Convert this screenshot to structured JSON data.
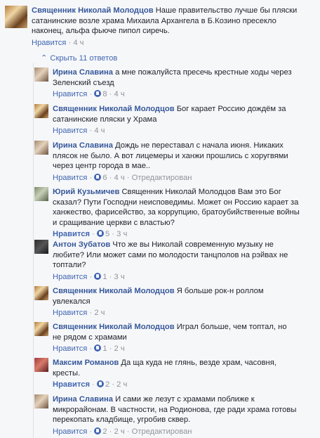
{
  "top_comment": {
    "author": "Священник Николай Молодцов",
    "text_lines": [
      "Наше правительство лучше бы пляски",
      "сатанинские возле храма Михаила Архангела в Б.Козино пресекло",
      "наконец, альфа фьюче пипол сиречь."
    ],
    "like_label": "Нравится",
    "time": "4 ч"
  },
  "replies_toggle": {
    "icon": "chevron-up-icon",
    "label": "Скрыть 11 ответов"
  },
  "replies": [
    {
      "author": "Ирина Славина",
      "text_lines": [
        "а мне пожалуйста пресечь крестные ходы через",
        "Зеленский съезд"
      ],
      "like_label": "Нравится",
      "reactions": "8",
      "time": "4 ч",
      "edited": ""
    },
    {
      "author": "Священник Николай Молодцов",
      "text_lines": [
        "Бог карает Россию дождём за",
        "сатанинские пляски у Храма"
      ],
      "like_label": "Нравится",
      "reactions": "",
      "time": "4 ч",
      "edited": ""
    },
    {
      "author": "Ирина Славина",
      "text_lines": [
        "Дождь не переставал с начала июня. Никаких",
        "плясок не было. А вот лицемеры и ханжи прошлись с хоругвями",
        "через центр города в мае.."
      ],
      "like_label": "Нравится",
      "reactions": "6",
      "time": "4 ч",
      "edited": "Отредактирован"
    },
    {
      "author": "Юрий Кузьмичев",
      "text_lines": [
        "Священник Николай Молодцов Вам это Бог",
        "сказал? Пути Господни неисповедимы. Может он Россию карает за",
        "ханжество, фарисейство, за коррупцию, братоубийственные войны",
        "и сращивание церкви с властью?"
      ],
      "like_label": "Нравится",
      "reactions": "5",
      "time": "3 ч",
      "edited": ""
    },
    {
      "author": "Антон Зубатов",
      "text_lines": [
        "Что же вы Николай современную музыку не",
        "любите? Или может сами по молодости танцполов на рэйвах не",
        "топтали?"
      ],
      "like_label": "Нравится",
      "reactions": "1",
      "time": "3 ч",
      "edited": ""
    },
    {
      "author": "Священник Николай Молодцов",
      "text_lines": [
        "Я больше рок-н роллом",
        "увлекался"
      ],
      "like_label": "Нравится",
      "reactions": "",
      "time": "2 ч",
      "edited": ""
    },
    {
      "author": "Священник Николай Молодцов",
      "text_lines": [
        "Играл больше, чем топтал, но",
        "не рядом с храмами"
      ],
      "like_label": "Нравится",
      "reactions": "1",
      "time": "2 ч",
      "edited": ""
    },
    {
      "author": "Максим Романов",
      "text_lines": [
        "Да ща куда не глянь, везде храм, часовня,",
        "кресты."
      ],
      "like_label": "Нравится",
      "reactions": "2",
      "time": "2 ч",
      "edited": ""
    },
    {
      "author": "Ирина Славина",
      "text_lines": [
        "И сами же лезут с храмами поближе к",
        "микрорайонам. В частности, на Родионова, где ради храма готовы",
        "перекопать кладбище, угробив сквер."
      ],
      "like_label": "Нравится",
      "reactions": "2",
      "time": "2 ч",
      "edited": "Отредактирован"
    }
  ],
  "colors": {
    "author": "#365899",
    "link": "#4267b2",
    "meta": "#90949c",
    "background": "#f6f7f9"
  }
}
